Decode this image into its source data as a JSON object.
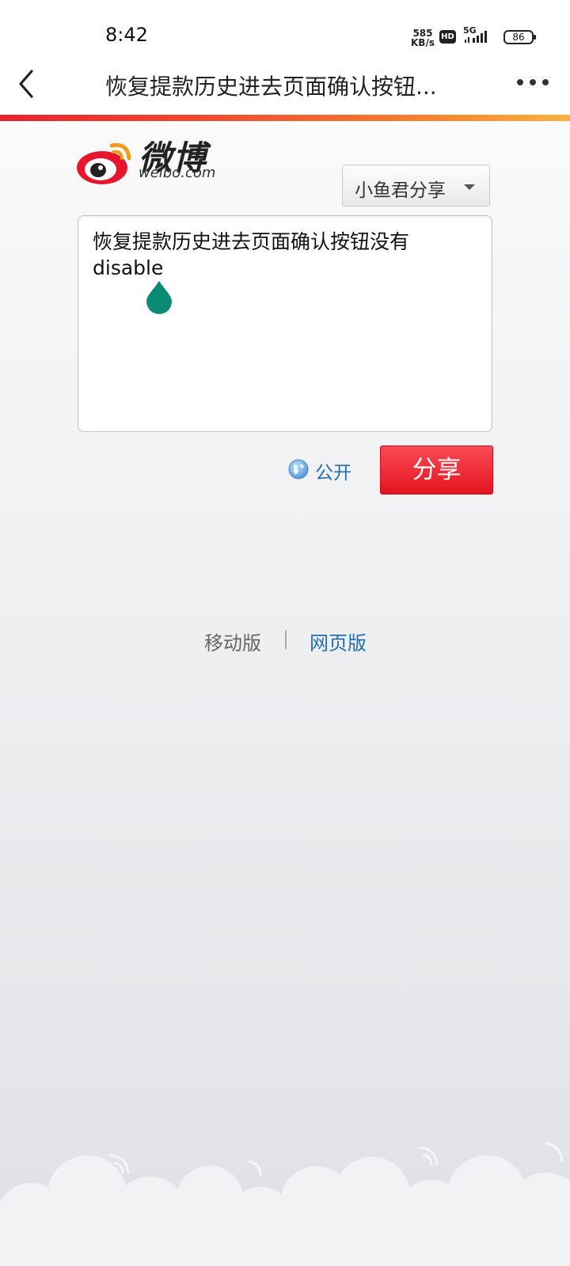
{
  "status_bar": {
    "time": "8:42",
    "net_speed_value": "585",
    "net_speed_unit": "KB/s",
    "hd_badge": "HD",
    "network": "5G",
    "battery": "86"
  },
  "nav": {
    "back_icon": "chevron-left-icon",
    "title": "恢复提款历史进去页面确认按钮...",
    "more_icon": "more-horizontal-icon"
  },
  "logo": {
    "text_cn": "微博",
    "text_en": "weibo.com"
  },
  "account": {
    "selected": "小鱼君分享"
  },
  "share_box": {
    "text": "恢复提款历史进去页面确认按钮没有disable"
  },
  "visibility": {
    "icon": "globe-icon",
    "label": "公开"
  },
  "share_button": {
    "label": "分享"
  },
  "footer": {
    "mobile_label": "移动版",
    "separator": "|",
    "web_label": "网页版"
  },
  "colors": {
    "accent_red": "#e3141f",
    "link_blue": "#1f6fb2",
    "cursor_handle": "#0b8a76"
  }
}
